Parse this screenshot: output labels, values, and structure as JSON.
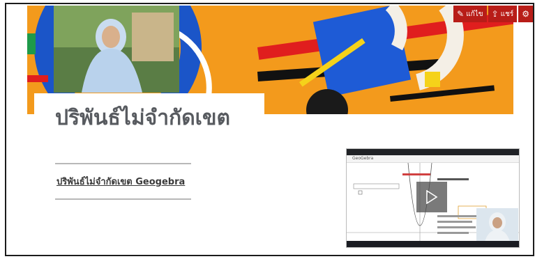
{
  "colors": {
    "banner": "#f39a1c",
    "title": "#585b60",
    "toolbar": "#b81d18"
  },
  "toolbar": {
    "edit_label": "แก้ไข",
    "share_label": "แชร์",
    "edit_icon": "pencil-icon",
    "share_icon": "share-icon",
    "more_icon": "settings-icon"
  },
  "page": {
    "title": "ปริพันธ์ไม่จำกัดเขต",
    "link_text": "ปริพันธ์ไม่จำกัดเขต Geogebra"
  },
  "video": {
    "app_name": "GeoGebra"
  }
}
